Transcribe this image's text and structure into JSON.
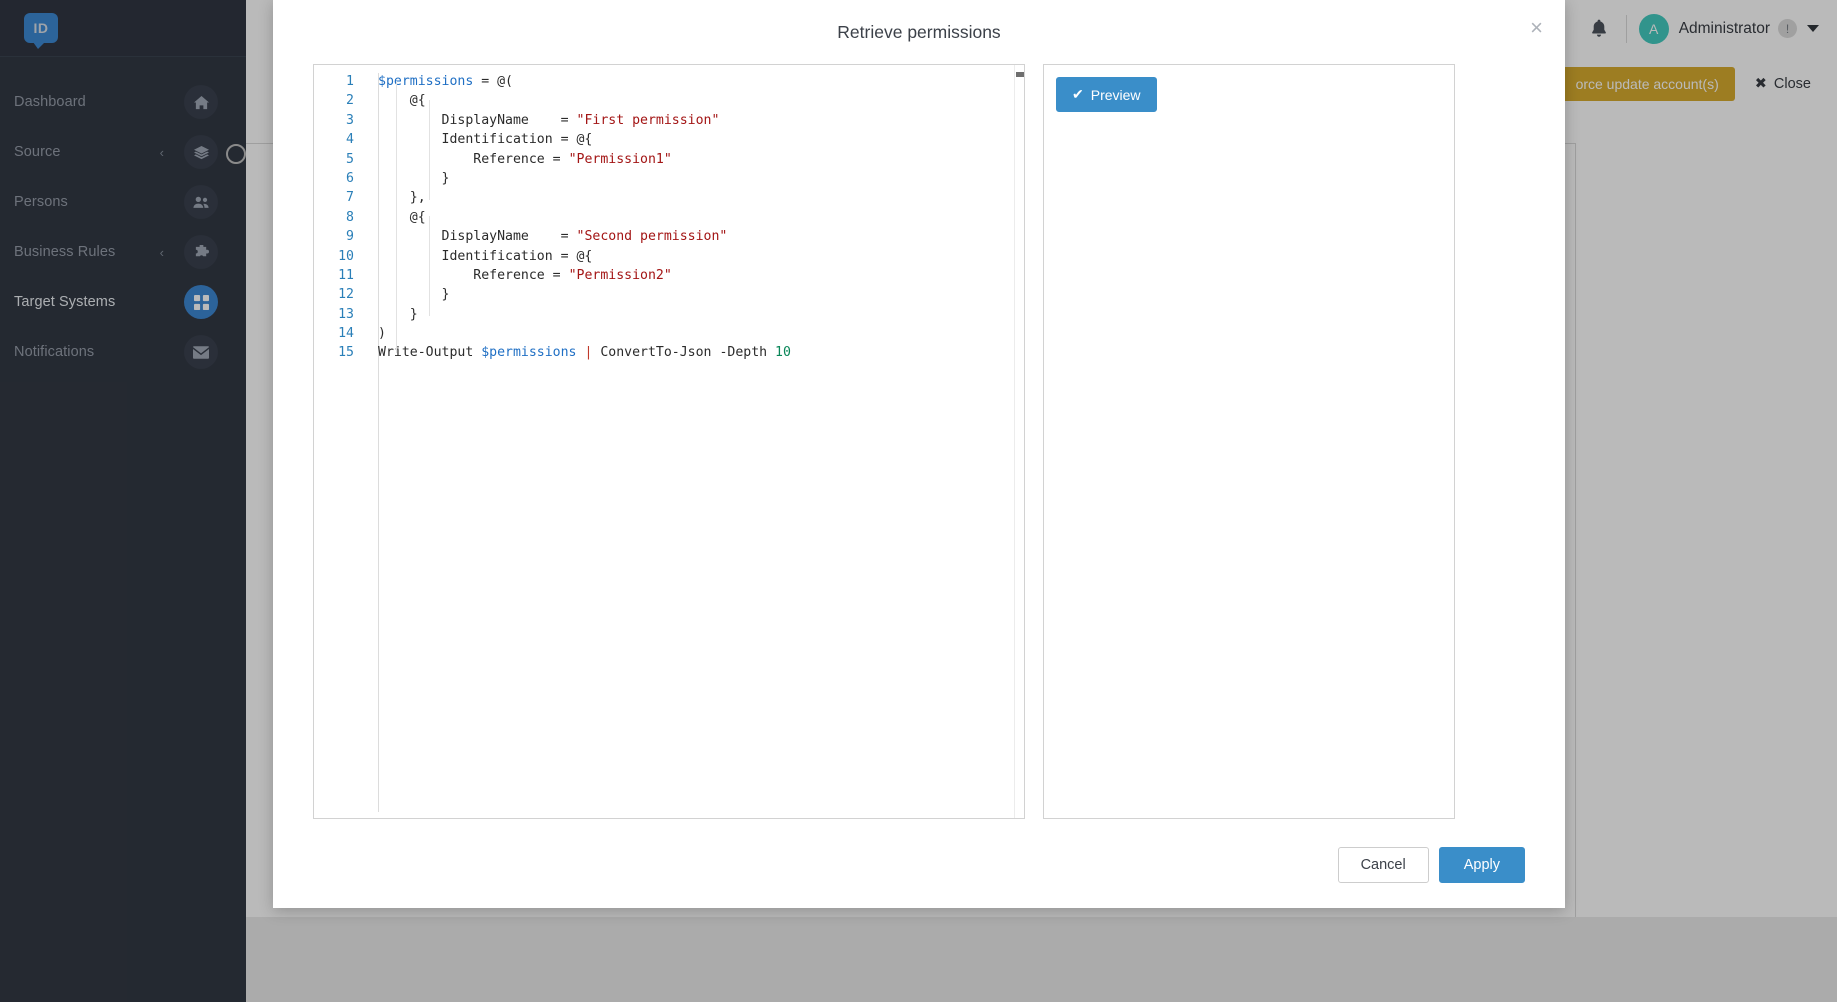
{
  "sidebar": {
    "logo_text": "ID",
    "items": [
      {
        "label": "Dashboard",
        "icon": "home-icon",
        "expandable": false,
        "active": false
      },
      {
        "label": "Source",
        "icon": "layers-icon",
        "expandable": true,
        "active": false
      },
      {
        "label": "Persons",
        "icon": "users-icon",
        "expandable": false,
        "active": false
      },
      {
        "label": "Business Rules",
        "icon": "puzzle-icon",
        "expandable": true,
        "active": false
      },
      {
        "label": "Target Systems",
        "icon": "grid-icon",
        "expandable": false,
        "active": true
      },
      {
        "label": "Notifications",
        "icon": "envelope-icon",
        "expandable": false,
        "active": false
      }
    ],
    "chevron_glyph": "‹",
    "bg_color": "#232a36",
    "active_icon_color": "#2f7fd0"
  },
  "header": {
    "bell_icon": "bell-icon",
    "avatar_initial": "A",
    "avatar_color": "#35c7bb",
    "user_name": "Administrator",
    "user_badge": "!",
    "caret_icon": "chevron-down-icon"
  },
  "page": {
    "force_update_label": "orce update account(s)",
    "close_label": "Close",
    "close_icon": "close-icon",
    "warning_color": "#d4a520"
  },
  "modal": {
    "title": "Retrieve permissions",
    "close_icon": "close-icon",
    "close_glyph": "×",
    "preview_button": {
      "label": "Preview",
      "icon": "check-icon",
      "glyph": "✔",
      "color": "#3a8ec9"
    },
    "footer": {
      "cancel_label": "Cancel",
      "apply_label": "Apply",
      "apply_color": "#3a8ec9"
    },
    "editor": {
      "language": "powershell",
      "lines": [
        {
          "n": 1,
          "indent": 0,
          "tokens": [
            {
              "t": "var",
              "v": "$permissions"
            },
            {
              "t": "plain",
              "v": " = @("
            }
          ]
        },
        {
          "n": 2,
          "indent": 1,
          "tokens": [
            {
              "t": "plain",
              "v": "    @{"
            }
          ]
        },
        {
          "n": 3,
          "indent": 2,
          "tokens": [
            {
              "t": "plain",
              "v": "        DisplayName    = "
            },
            {
              "t": "str",
              "v": "\"First permission\""
            }
          ]
        },
        {
          "n": 4,
          "indent": 2,
          "tokens": [
            {
              "t": "plain",
              "v": "        Identification = @{"
            }
          ]
        },
        {
          "n": 5,
          "indent": 3,
          "tokens": [
            {
              "t": "plain",
              "v": "            Reference = "
            },
            {
              "t": "str",
              "v": "\"Permission1\""
            }
          ]
        },
        {
          "n": 6,
          "indent": 2,
          "tokens": [
            {
              "t": "plain",
              "v": "        }"
            }
          ]
        },
        {
          "n": 7,
          "indent": 1,
          "tokens": [
            {
              "t": "plain",
              "v": "    },"
            }
          ]
        },
        {
          "n": 8,
          "indent": 1,
          "tokens": [
            {
              "t": "plain",
              "v": "    @{"
            }
          ]
        },
        {
          "n": 9,
          "indent": 2,
          "tokens": [
            {
              "t": "plain",
              "v": "        DisplayName    = "
            },
            {
              "t": "str",
              "v": "\"Second permission\""
            }
          ]
        },
        {
          "n": 10,
          "indent": 2,
          "tokens": [
            {
              "t": "plain",
              "v": "        Identification = @{"
            }
          ]
        },
        {
          "n": 11,
          "indent": 3,
          "tokens": [
            {
              "t": "plain",
              "v": "            Reference = "
            },
            {
              "t": "str",
              "v": "\"Permission2\""
            }
          ]
        },
        {
          "n": 12,
          "indent": 2,
          "tokens": [
            {
              "t": "plain",
              "v": "        }"
            }
          ]
        },
        {
          "n": 13,
          "indent": 1,
          "tokens": [
            {
              "t": "plain",
              "v": "    }"
            }
          ]
        },
        {
          "n": 14,
          "indent": 0,
          "tokens": [
            {
              "t": "plain",
              "v": ")"
            }
          ]
        },
        {
          "n": 15,
          "indent": 0,
          "tokens": [
            {
              "t": "plain",
              "v": "Write-Output "
            },
            {
              "t": "var",
              "v": "$permissions"
            },
            {
              "t": "plain",
              "v": " "
            },
            {
              "t": "pipe",
              "v": "|"
            },
            {
              "t": "plain",
              "v": " ConvertTo-Json -Depth "
            },
            {
              "t": "num",
              "v": "10"
            }
          ]
        }
      ],
      "colors": {
        "line_number": "#2a7fb8",
        "variable": "#1f6fc4",
        "string": "#a31515",
        "number": "#098658",
        "pipe": "#c0392b",
        "plain": "#2b2b2b"
      }
    }
  }
}
